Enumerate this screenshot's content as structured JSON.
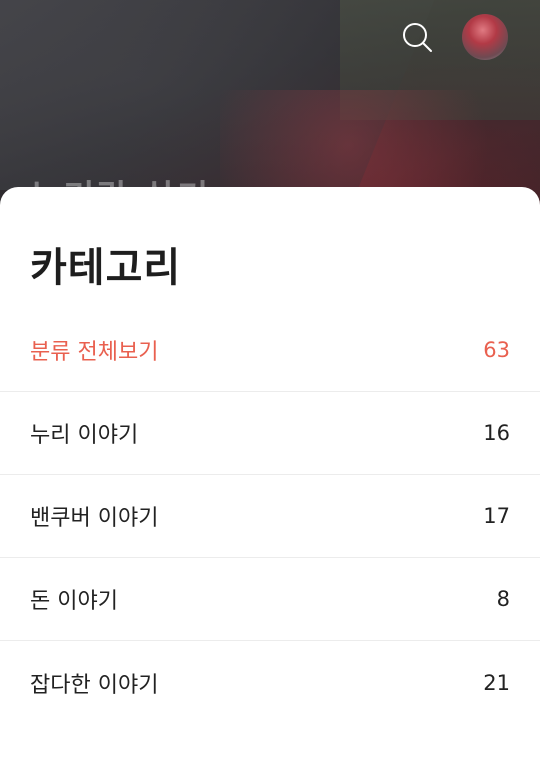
{
  "hero": {
    "blog_title": "누리랑 살기"
  },
  "header": {
    "search_icon": "search-icon",
    "avatar": "profile-avatar"
  },
  "sheet": {
    "title": "카테고리",
    "accent_color": "#e9604f",
    "categories": [
      {
        "label": "분류 전체보기",
        "count": "63",
        "active": true
      },
      {
        "label": "누리 이야기",
        "count": "16",
        "active": false
      },
      {
        "label": "밴쿠버 이야기",
        "count": "17",
        "active": false
      },
      {
        "label": "돈 이야기",
        "count": "8",
        "active": false
      },
      {
        "label": "잡다한 이야기",
        "count": "21",
        "active": false
      }
    ]
  }
}
